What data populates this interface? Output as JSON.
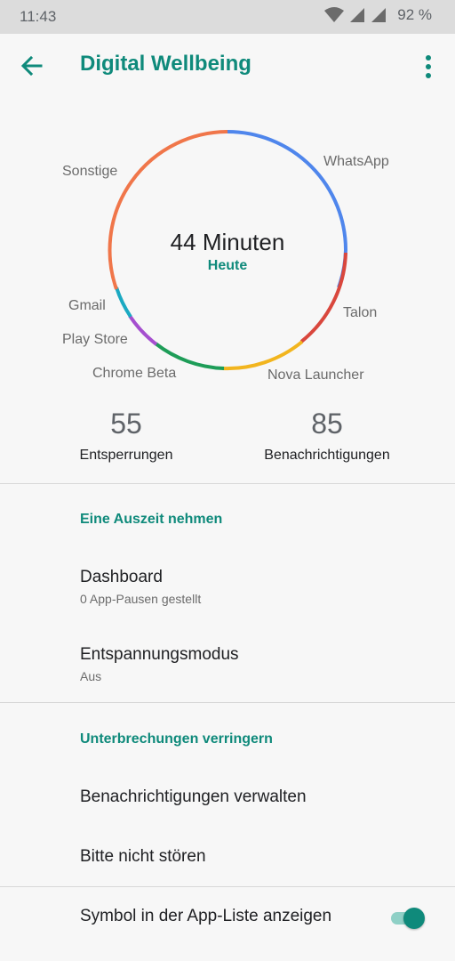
{
  "status_bar": {
    "time": "11:43",
    "battery": "92 %",
    "icons": [
      "wifi-icon",
      "cell-signal-icon",
      "cell-signal-icon",
      "battery-icon"
    ]
  },
  "app_bar": {
    "title": "Digital Wellbeing",
    "back_icon": "arrow-back-icon",
    "more_icon": "more-vert-icon"
  },
  "usage_chart": {
    "center_value": "44 Minuten",
    "center_subtitle": "Heute",
    "apps": [
      {
        "name": "WhatsApp",
        "color": "#4f86ec"
      },
      {
        "name": "Talon",
        "color": "#d9473d"
      },
      {
        "name": "Nova Launcher",
        "color": "#f2b51e"
      },
      {
        "name": "Chrome Beta",
        "color": "#1e9d58"
      },
      {
        "name": "Play Store",
        "color": "#a54fcf"
      },
      {
        "name": "Gmail",
        "color": "#1ba9c2"
      },
      {
        "name": "Sonstige",
        "color": "#f0764a"
      }
    ]
  },
  "stats": {
    "unlocks": {
      "value": "55",
      "label": "Entsperrungen"
    },
    "notifications": {
      "value": "85",
      "label": "Benachrichtigungen"
    }
  },
  "sections": {
    "downtime": {
      "title": "Eine Auszeit nehmen",
      "dashboard": {
        "title": "Dashboard",
        "subtitle": "0 App-Pausen gestellt"
      },
      "wind_down": {
        "title": "Entspannungsmodus",
        "subtitle": "Aus"
      }
    },
    "interruptions": {
      "title": "Unterbrechungen verringern",
      "manage_notifications": "Benachrichtigungen verwalten",
      "do_not_disturb": "Bitte nicht stören"
    },
    "show_icon": {
      "label": "Symbol in der App-Liste anzeigen",
      "enabled": true
    }
  },
  "colors": {
    "accent": "#0f8a7b"
  }
}
